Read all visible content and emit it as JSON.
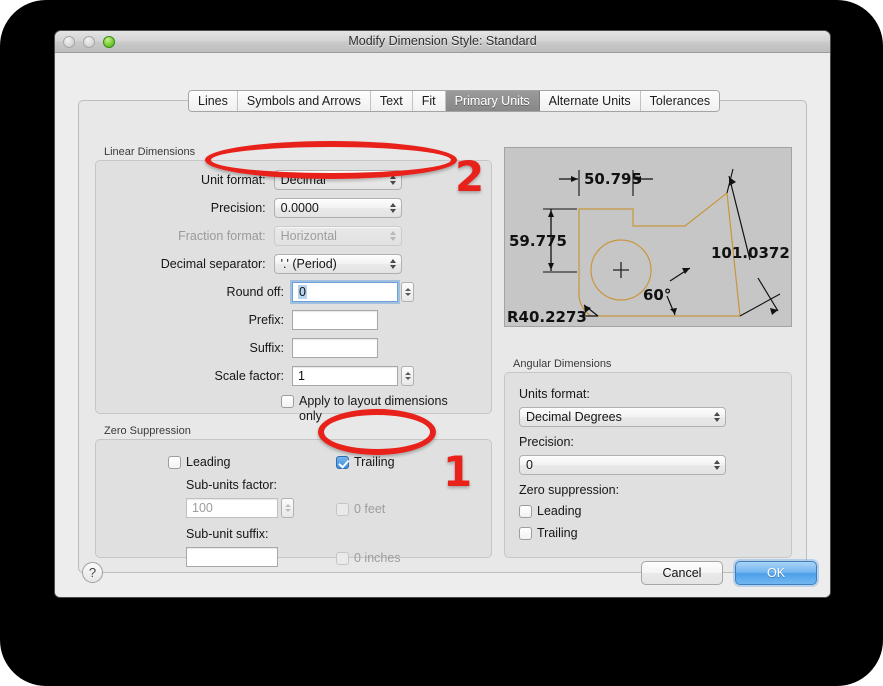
{
  "window": {
    "title": "Modify Dimension Style: Standard",
    "traffic_lights": [
      "close-disabled",
      "minimize-disabled",
      "zoom-green"
    ]
  },
  "tabs": [
    {
      "label": "Lines",
      "active": false
    },
    {
      "label": "Symbols and Arrows",
      "active": false
    },
    {
      "label": "Text",
      "active": false
    },
    {
      "label": "Fit",
      "active": false
    },
    {
      "label": "Primary Units",
      "active": true
    },
    {
      "label": "Alternate Units",
      "active": false
    },
    {
      "label": "Tolerances",
      "active": false
    }
  ],
  "linear_dimensions": {
    "group_label": "Linear Dimensions",
    "unit_format": {
      "label": "Unit format:",
      "value": "Decimal",
      "enabled": true
    },
    "precision": {
      "label": "Precision:",
      "value": "0.0000",
      "enabled": true
    },
    "fraction_format": {
      "label": "Fraction format:",
      "value": "Horizontal",
      "enabled": false
    },
    "decimal_separator": {
      "label": "Decimal separator:",
      "value": "'.' (Period)",
      "enabled": true
    },
    "round_off": {
      "label": "Round off:",
      "value": "0",
      "enabled": true,
      "focused": true
    },
    "prefix": {
      "label": "Prefix:",
      "value": "",
      "enabled": true
    },
    "suffix": {
      "label": "Suffix:",
      "value": "",
      "enabled": true
    },
    "scale_factor": {
      "label": "Scale factor:",
      "value": "1",
      "enabled": true
    },
    "apply_to_layout": {
      "label": "Apply to layout dimensions only",
      "checked": false
    }
  },
  "zero_suppression": {
    "group_label": "Zero Suppression",
    "leading": {
      "label": "Leading",
      "checked": false
    },
    "trailing": {
      "label": "Trailing",
      "checked": true
    },
    "sub_units_factor": {
      "label": "Sub-units factor:",
      "value": "100",
      "enabled": false
    },
    "sub_unit_suffix": {
      "label": "Sub-unit suffix:",
      "value": "",
      "enabled": false
    },
    "zero_feet": {
      "label": "0 feet",
      "checked": false,
      "enabled": false
    },
    "zero_inches": {
      "label": "0 inches",
      "checked": false,
      "enabled": false
    }
  },
  "angular_dimensions": {
    "group_label": "Angular Dimensions",
    "units_format": {
      "label": "Units format:",
      "value": "Decimal Degrees"
    },
    "precision": {
      "label": "Precision:",
      "value": "0"
    },
    "zero_suppression_label": "Zero suppression:",
    "leading": {
      "label": "Leading",
      "checked": false
    },
    "trailing": {
      "label": "Trailing",
      "checked": false
    }
  },
  "preview": {
    "dim_top": "50.795",
    "dim_left": "59.775",
    "dim_right": "101.0372",
    "dim_angle": "60°",
    "dim_radius": "R40.2273",
    "background_color": "#c6c6c6",
    "shape_color": "#c8963c"
  },
  "buttons": {
    "help": "?",
    "cancel": "Cancel",
    "ok": "OK"
  },
  "annotations": {
    "color": "#e8211a",
    "marker_one": "1",
    "marker_two": "2"
  }
}
